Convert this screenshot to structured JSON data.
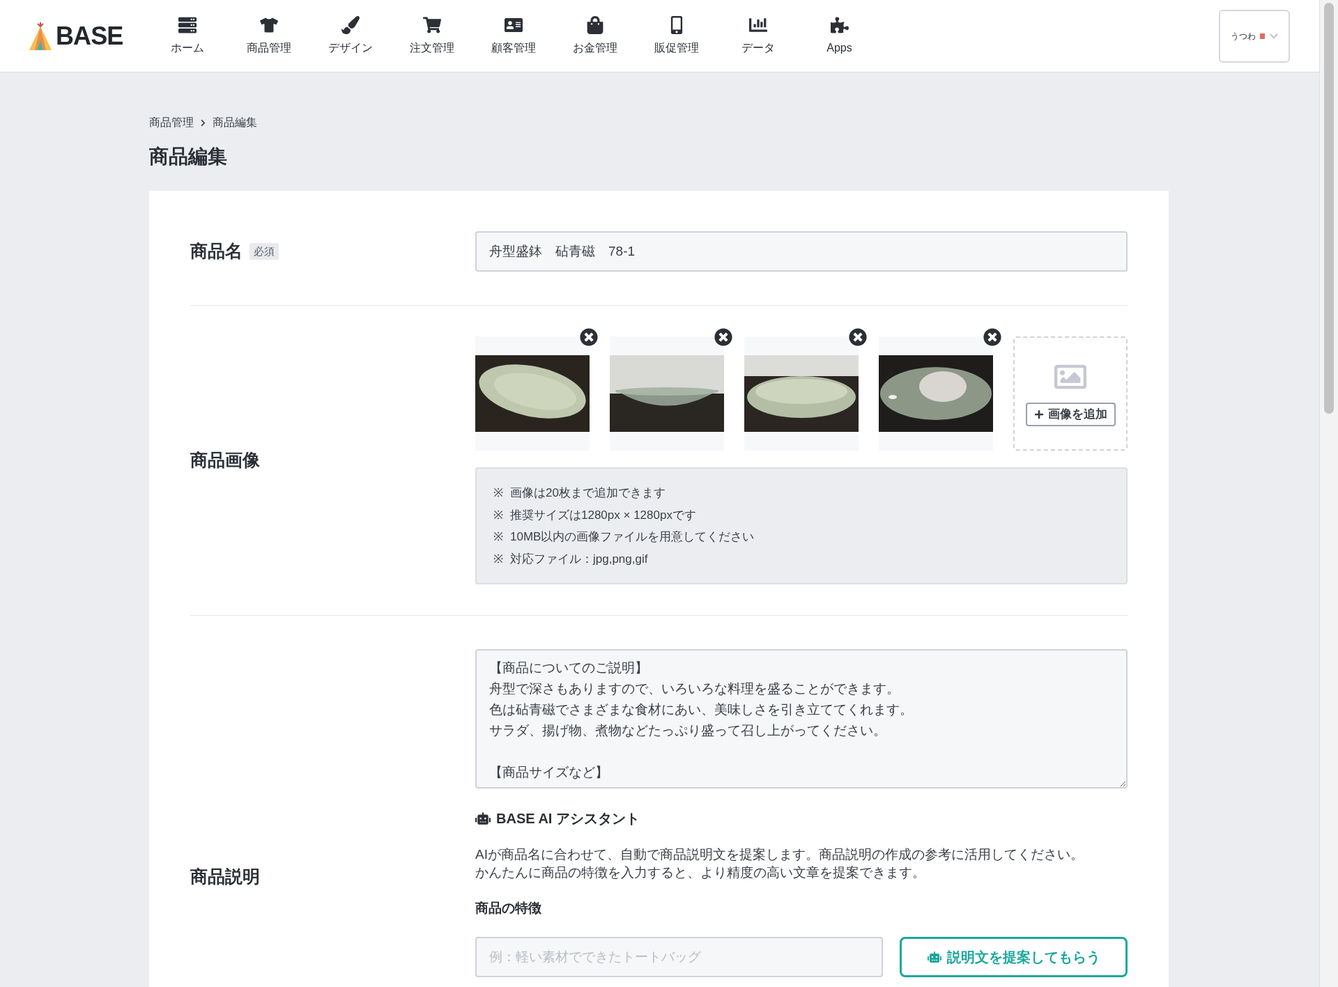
{
  "header": {
    "logo": "BASE",
    "nav": [
      {
        "label": "ホーム",
        "selected": false
      },
      {
        "label": "商品管理",
        "selected": false
      },
      {
        "label": "デザイン",
        "selected": false
      },
      {
        "label": "注文管理",
        "selected": false
      },
      {
        "label": "顧客管理",
        "selected": false
      },
      {
        "label": "お金管理",
        "selected": false
      },
      {
        "label": "販促管理",
        "selected": false
      },
      {
        "label": "データ",
        "selected": false
      },
      {
        "label": "Apps",
        "selected": false
      }
    ],
    "shop": "うつわ"
  },
  "breadcrumb": [
    "商品管理",
    "商品編集"
  ],
  "page_title": "商品編集",
  "form": {
    "name": {
      "label": "商品名",
      "badge": "必須",
      "value": "舟型盛鉢　砧青磁　78-1"
    },
    "images": {
      "label": "商品画像",
      "add_button": "画像を追加",
      "notes": [
        {
          "mark": "※",
          "text": "画像は20枚まで追加できます"
        },
        {
          "mark": "※",
          "text": "推奨サイズは1280px × 1280pxです"
        },
        {
          "mark": "※",
          "text": "10MB以内の画像ファイルを用意してください"
        },
        {
          "mark": "※",
          "text": "対応ファイル：jpg,png,gif"
        }
      ]
    },
    "description": {
      "label": "商品説明",
      "paragraphs": [
        [
          "【商品についてのご説明】",
          "舟型で深さもありますので、いろいろな料理を盛ることができます。",
          "色は砧青磁でさまざまな食材にあい、美味しさを引き立ててくれます。",
          "サラダ、揚げ物、煮物などたっぷり盛って召し上がってください。"
        ],
        [
          "【商品サイズなど】"
        ]
      ],
      "ai": {
        "title": "BASE AI アシスタント",
        "text_lines": [
          "AIが商品名に合わせて、自動で商品説明文を提案します。商品説明の作成の参考に活用してください。",
          "かんたんに商品の特徴を入力すると、より精度の高い文章を提案できます。"
        ],
        "feature_label": "商品の特徴",
        "feature_placeholder": "例：軽い素材でできたトートバッグ",
        "suggest_button": "説明文を提案してもらう"
      }
    }
  }
}
